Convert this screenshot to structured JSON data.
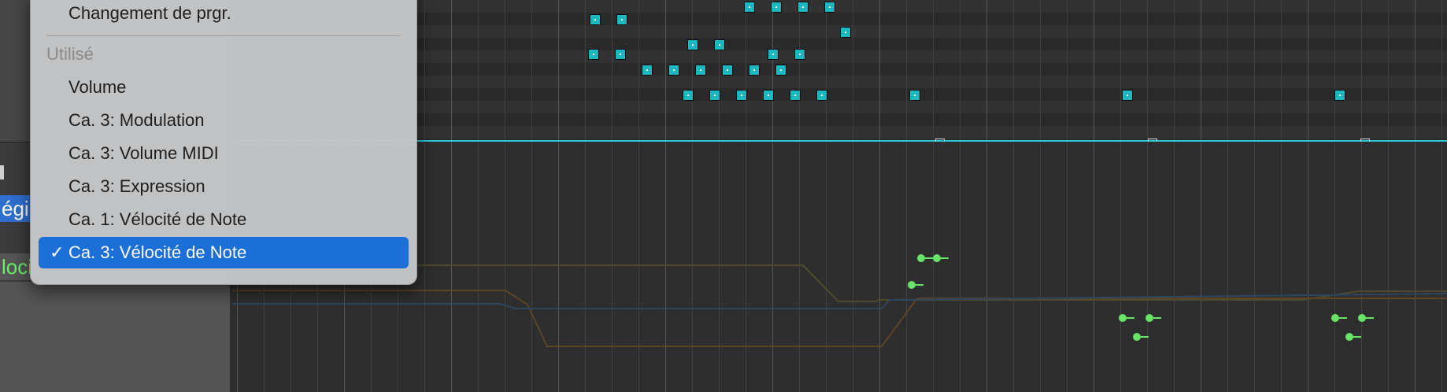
{
  "menu": {
    "top_item": "Changement de prgr.",
    "section_header": "Utilisé",
    "items": [
      {
        "label": "Volume"
      },
      {
        "label": "Ca. 3: Modulation"
      },
      {
        "label": "Ca. 3: Volume MIDI"
      },
      {
        "label": "Ca. 3: Expression"
      },
      {
        "label": "Ca. 1: Vélocité de Note"
      },
      {
        "label": "Ca. 3: Vélocité de Note",
        "selected": true,
        "check": "✓"
      }
    ]
  },
  "inspector": {
    "region_label": "égi",
    "lane_label": "loci"
  },
  "colors": {
    "note": "#1cb8c2",
    "playhead": "#2ec7d6",
    "velocity_point": "#6ae36a",
    "selection": "#1d6fd8"
  }
}
